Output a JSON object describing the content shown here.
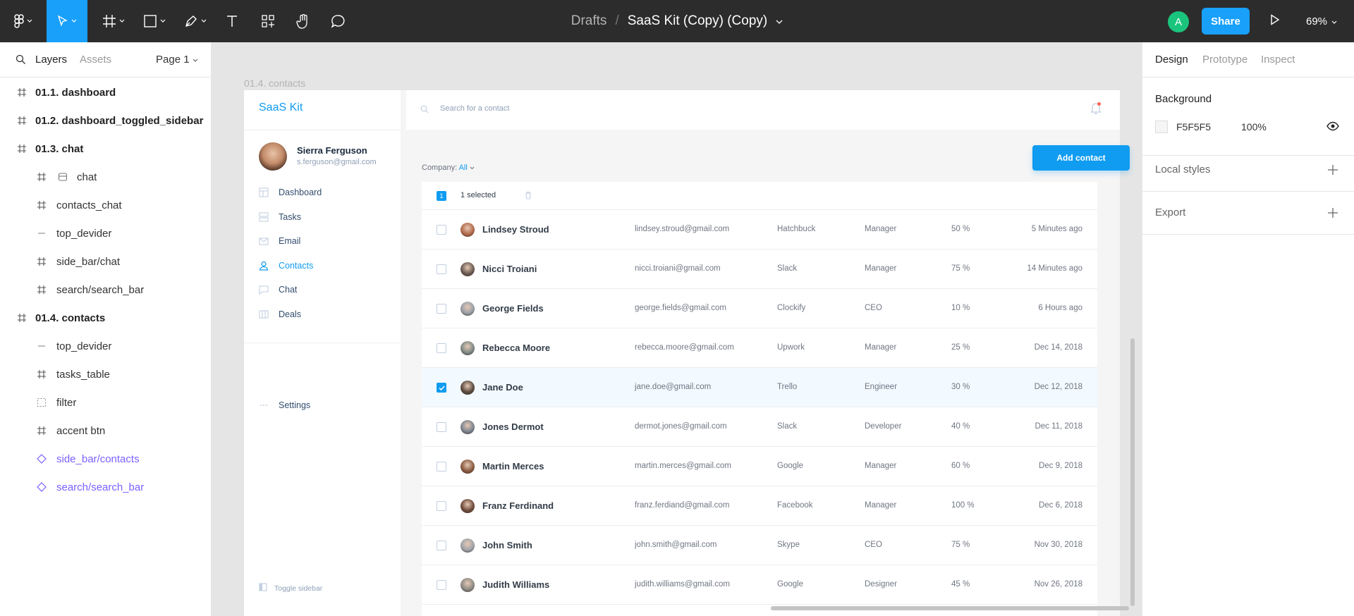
{
  "toolbar": {
    "breadcrumb_parent": "Drafts",
    "breadcrumb_sep": "/",
    "doc_title": "SaaS Kit (Copy) (Copy)",
    "avatar_letter": "A",
    "share_label": "Share",
    "zoom": "69%",
    "tools": [
      "figma-menu-icon",
      "move-tool-icon",
      "frame-tool-icon",
      "shape-tool-icon",
      "pen-tool-icon",
      "text-tool-icon",
      "components-icon",
      "hand-tool-icon",
      "comment-tool-icon"
    ],
    "accent": "#18a0fb"
  },
  "left_panel": {
    "tabs": [
      "Layers",
      "Assets"
    ],
    "page": "Page 1",
    "layers": [
      {
        "label": "01.1. dashboard",
        "icon": "frame-icon",
        "level": 0,
        "style": "bold"
      },
      {
        "label": "01.2. dashboard_toggled_sidebar",
        "icon": "frame-icon",
        "level": 0,
        "style": "bold"
      },
      {
        "label": "01.3. chat",
        "icon": "frame-icon",
        "level": 0,
        "style": "bold"
      },
      {
        "label": "chat",
        "icon": "frame-icon",
        "level": 1,
        "style": "normal",
        "extra_icon": "group-icon"
      },
      {
        "label": "contacts_chat",
        "icon": "frame-icon",
        "level": 1,
        "style": "normal"
      },
      {
        "label": "top_devider",
        "icon": "line-icon",
        "level": 1,
        "style": "normal"
      },
      {
        "label": "side_bar/chat",
        "icon": "frame-icon",
        "level": 1,
        "style": "normal"
      },
      {
        "label": "search/search_bar",
        "icon": "frame-icon",
        "level": 1,
        "style": "normal"
      },
      {
        "label": "01.4. contacts",
        "icon": "frame-icon",
        "level": 0,
        "style": "bold"
      },
      {
        "label": "top_devider",
        "icon": "line-icon",
        "level": 1,
        "style": "normal"
      },
      {
        "label": "tasks_table",
        "icon": "frame-icon",
        "level": 1,
        "style": "normal"
      },
      {
        "label": "filter",
        "icon": "dashed-frame-icon",
        "level": 1,
        "style": "normal"
      },
      {
        "label": "accent btn",
        "icon": "frame-icon",
        "level": 1,
        "style": "normal"
      },
      {
        "label": "side_bar/contacts",
        "icon": "component-instance-icon",
        "level": 1,
        "style": "comp"
      },
      {
        "label": "search/search_bar",
        "icon": "component-instance-icon",
        "level": 1,
        "style": "comp"
      }
    ]
  },
  "canvas": {
    "frame_label": "01.4. contacts",
    "app": {
      "logo": "SaaS Kit",
      "user_name": "Sierra Ferguson",
      "user_email": "s.ferguson@gmail.com",
      "nav": [
        {
          "label": "Dashboard",
          "icon": "dashboard-icon",
          "active": false
        },
        {
          "label": "Tasks",
          "icon": "tasks-icon",
          "active": false
        },
        {
          "label": "Email",
          "icon": "email-icon",
          "active": false
        },
        {
          "label": "Contacts",
          "icon": "contacts-icon",
          "active": true
        },
        {
          "label": "Chat",
          "icon": "chat-icon",
          "active": false
        },
        {
          "label": "Deals",
          "icon": "deals-icon",
          "active": false
        }
      ],
      "settings_label": "Settings",
      "toggle_label": "Toggle sidebar",
      "search_placeholder": "Search for a contact",
      "company_label": "Company:",
      "company_value": "All",
      "add_contact_label": "Add contact",
      "selected_count": "1",
      "selected_text": "1 selected",
      "contacts": [
        {
          "name": "Lindsey Stroud",
          "email": "lindsey.stroud@gmail.com",
          "company": "Hatchbuck",
          "position": "Manager",
          "percent": "50 %",
          "time": "5 Minutes ago",
          "checked": false,
          "avatar_color": "#b36a4c"
        },
        {
          "name": "Nicci Troiani",
          "email": "nicci.troiani@gmail.com",
          "company": "Slack",
          "position": "Manager",
          "percent": "75 %",
          "time": "14 Minutes ago",
          "checked": false,
          "avatar_color": "#6b5b52"
        },
        {
          "name": "George Fields",
          "email": "george.fields@gmail.com",
          "company": "Clockify",
          "position": "CEO",
          "percent": "10 %",
          "time": "6 Hours ago",
          "checked": false,
          "avatar_color": "#9aa0a8"
        },
        {
          "name": "Rebecca Moore",
          "email": "rebecca.moore@gmail.com",
          "company": "Upwork",
          "position": "Manager",
          "percent": "25 %",
          "time": "Dec 14, 2018",
          "checked": false,
          "avatar_color": "#7f8a86"
        },
        {
          "name": "Jane Doe",
          "email": "jane.doe@gmail.com",
          "company": "Trello",
          "position": "Engineer",
          "percent": "30 %",
          "time": "Dec 12, 2018",
          "checked": true,
          "avatar_color": "#5a4a3e"
        },
        {
          "name": "Jones Dermot",
          "email": "dermot.jones@gmail.com",
          "company": "Slack",
          "position": "Developer",
          "percent": "40 %",
          "time": "Dec 11, 2018",
          "checked": false,
          "avatar_color": "#7d8590"
        },
        {
          "name": "Martin Merces",
          "email": "martin.merces@gmail.com",
          "company": "Google",
          "position": "Manager",
          "percent": "60 %",
          "time": "Dec 9, 2018",
          "checked": false,
          "avatar_color": "#8a5a40"
        },
        {
          "name": "Franz Ferdinand",
          "email": "franz.ferdiand@gmail.com",
          "company": "Facebook",
          "position": "Manager",
          "percent": "100 %",
          "time": "Dec 6, 2018",
          "checked": false,
          "avatar_color": "#6e4b3a"
        },
        {
          "name": "John Smith",
          "email": "john.smith@gmail.com",
          "company": "Skype",
          "position": "CEO",
          "percent": "75 %",
          "time": "Nov 30, 2018",
          "checked": false,
          "avatar_color": "#a0a4aa"
        },
        {
          "name": "Judith Williams",
          "email": "judith.williams@gmail.com",
          "company": "Google",
          "position": "Designer",
          "percent": "45 %",
          "time": "Nov 26, 2018",
          "checked": false,
          "avatar_color": "#8e8b86"
        }
      ]
    },
    "help_label": "?"
  },
  "right_panel": {
    "tabs": [
      "Design",
      "Prototype",
      "Inspect"
    ],
    "background_title": "Background",
    "bg_hex": "F5F5F5",
    "bg_opacity": "100%",
    "local_styles": "Local styles",
    "export": "Export"
  }
}
